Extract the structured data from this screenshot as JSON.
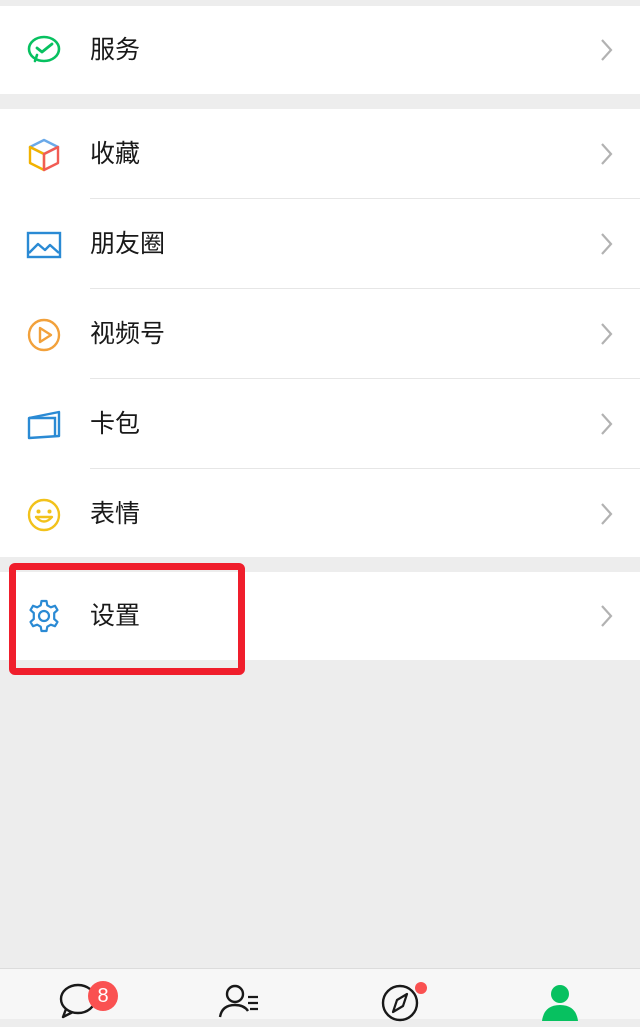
{
  "colors": {
    "accent_green": "#07c160",
    "badge_red": "#fa5151",
    "highlight_red": "#f01e2c"
  },
  "menu": {
    "service": {
      "label": "服务",
      "icon": "wechat-pay-icon"
    },
    "main": [
      {
        "label": "收藏",
        "icon": "favorites-cube-icon"
      },
      {
        "label": "朋友圈",
        "icon": "moments-photo-icon"
      },
      {
        "label": "视频号",
        "icon": "channels-play-icon"
      },
      {
        "label": "卡包",
        "icon": "card-wallet-icon"
      },
      {
        "label": "表情",
        "icon": "stickers-smiley-icon"
      }
    ],
    "settings": {
      "label": "设置",
      "icon": "settings-gear-icon"
    }
  },
  "tabbar": {
    "chats_badge": "8",
    "items": [
      {
        "icon": "chats-bubble-icon"
      },
      {
        "icon": "contacts-icon"
      },
      {
        "icon": "discover-compass-icon"
      },
      {
        "icon": "me-person-icon",
        "active": true
      }
    ]
  }
}
